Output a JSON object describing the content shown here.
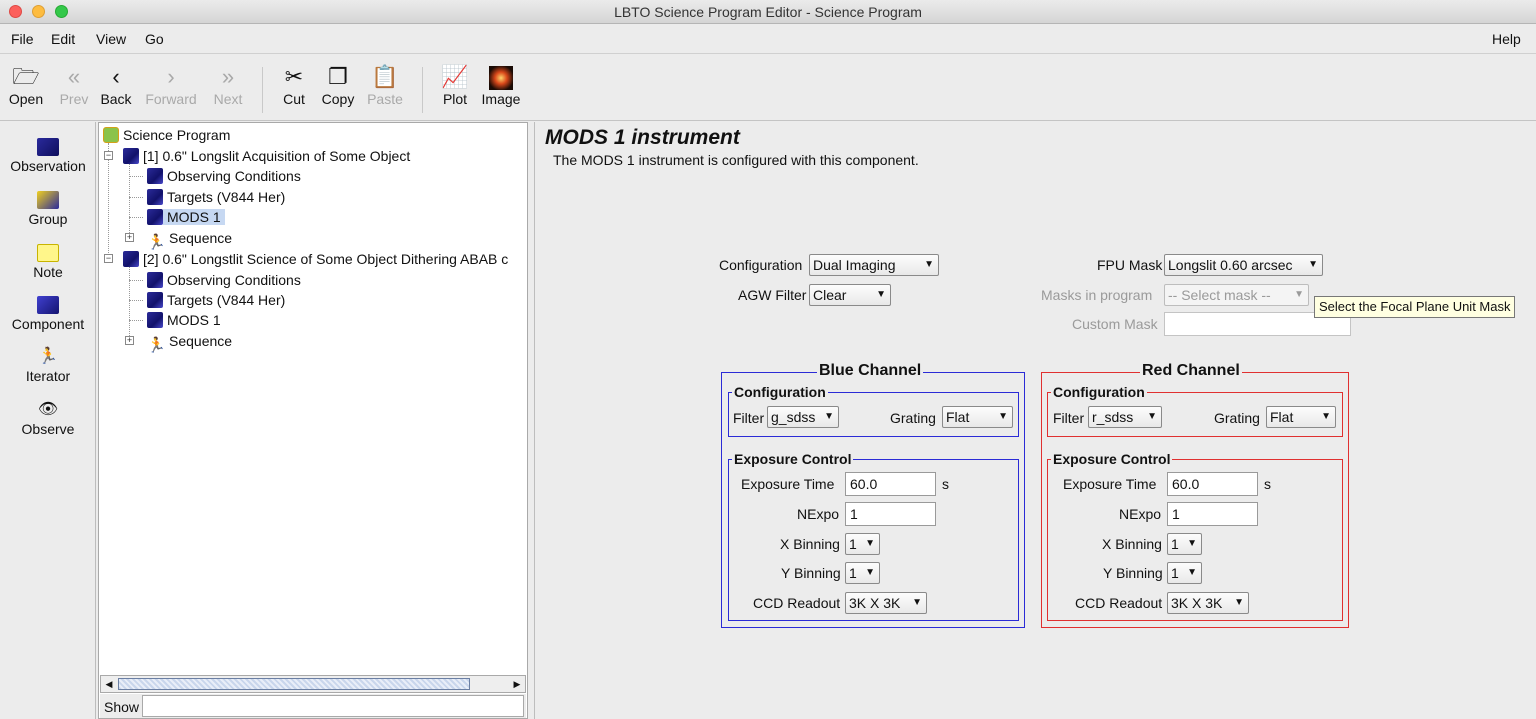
{
  "window": {
    "title": "LBTO Science Program Editor - Science Program"
  },
  "menu": {
    "file": "File",
    "edit": "Edit",
    "view": "View",
    "go": "Go",
    "help": "Help"
  },
  "toolbar": {
    "open": "Open",
    "prev": "Prev",
    "back": "Back",
    "forward": "Forward",
    "next": "Next",
    "cut": "Cut",
    "copy": "Copy",
    "paste": "Paste",
    "plot": "Plot",
    "image": "Image"
  },
  "palette": {
    "observation": "Observation",
    "group": "Group",
    "note": "Note",
    "component": "Component",
    "iterator": "Iterator",
    "observe": "Observe"
  },
  "tree": {
    "root": "Science Program",
    "obs1": "[1] 0.6\" Longslit Acquisition of Some Object",
    "obs1_children": [
      "Observing Conditions",
      "Targets (V844 Her)",
      "MODS 1",
      "Sequence"
    ],
    "obs2": "[2] 0.6\" Longstlit Science of Some Object Dithering ABAB c",
    "obs2_children": [
      "Observing Conditions",
      "Targets (V844 Her)",
      "MODS 1",
      "Sequence"
    ]
  },
  "show": {
    "label": "Show",
    "value": ""
  },
  "editor": {
    "title": "MODS 1 instrument",
    "description": "The MODS 1 instrument is configured with this component.",
    "configuration_label": "Configuration",
    "configuration_value": "Dual Imaging",
    "agw_label": "AGW Filter",
    "agw_value": "Clear",
    "fpu_label": "FPU Mask",
    "fpu_value": "Longslit 0.60 arcsec",
    "masks_label": "Masks in program",
    "masks_value": "-- Select mask --",
    "custom_label": "Custom Mask",
    "custom_value": "",
    "tooltip": "Select the Focal Plane Unit Mask"
  },
  "blue": {
    "title": "Blue Channel",
    "config_title": "Configuration",
    "filter_label": "Filter",
    "filter_value": "g_sdss",
    "grating_label": "Grating",
    "grating_value": "Flat",
    "exposure_title": "Exposure Control",
    "exptime_label": "Exposure Time",
    "exptime_value": "60.0",
    "exptime_unit": "s",
    "nexpo_label": "NExpo",
    "nexpo_value": "1",
    "xbin_label": "X Binning",
    "xbin_value": "1",
    "ybin_label": "Y Binning",
    "ybin_value": "1",
    "ccd_label": "CCD Readout",
    "ccd_value": "3K X 3K"
  },
  "red": {
    "title": "Red Channel",
    "config_title": "Configuration",
    "filter_label": "Filter",
    "filter_value": "r_sdss",
    "grating_label": "Grating",
    "grating_value": "Flat",
    "exposure_title": "Exposure Control",
    "exptime_label": "Exposure Time",
    "exptime_value": "60.0",
    "exptime_unit": "s",
    "nexpo_label": "NExpo",
    "nexpo_value": "1",
    "xbin_label": "X Binning",
    "xbin_value": "1",
    "ybin_label": "Y Binning",
    "ybin_value": "1",
    "ccd_label": "CCD Readout",
    "ccd_value": "3K X 3K"
  },
  "colors": {
    "blue_channel": "#2b2bd6",
    "red_channel": "#e03030",
    "selection": "#c6d8f2",
    "tooltip_bg": "#ffffe1"
  }
}
